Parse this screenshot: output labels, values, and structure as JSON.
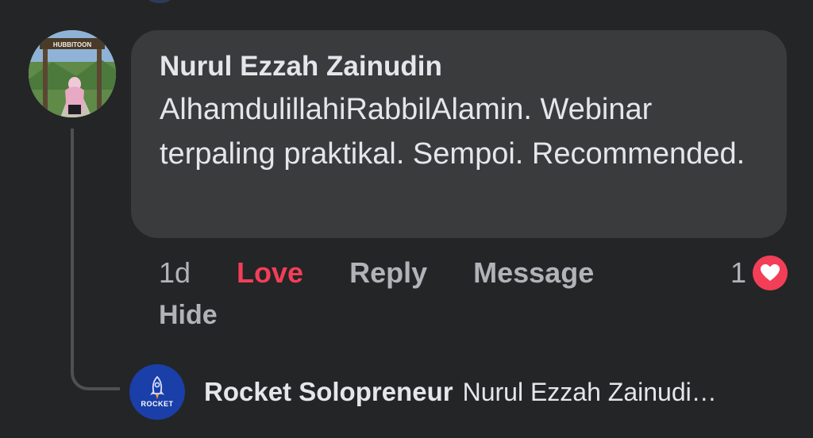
{
  "comment": {
    "author": "Nurul Ezzah Zainudin",
    "text": "AlhamdulillahiRabbilAlamin. Webinar terpaling praktikal. Sempoi. Recommended.",
    "avatar_icon": "profile-photo",
    "avatar_sign": "HUBBITOON"
  },
  "actions": {
    "time": "1d",
    "love_label": "Love",
    "reply_label": "Reply",
    "message_label": "Message",
    "hide_label": "Hide"
  },
  "reaction": {
    "count": "1",
    "icon": "heart-icon",
    "color": "#f33e58"
  },
  "reply": {
    "author": "Rocket Solopreneur",
    "preview": "Nurul Ezzah Zainudi…",
    "avatar_text": "ROCKET",
    "avatar_icon": "rocket-icon"
  },
  "colors": {
    "background": "#242526",
    "bubble": "#3a3b3c",
    "text": "#e4e6eb",
    "secondary": "#b0b3b8",
    "love": "#f33e58"
  }
}
